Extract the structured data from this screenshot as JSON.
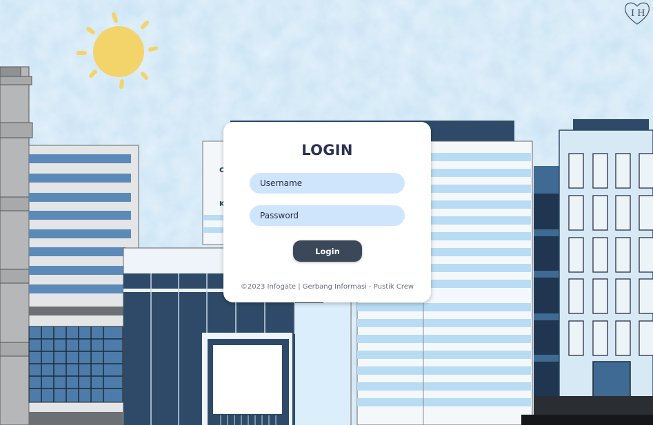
{
  "login": {
    "title": "LOGIN",
    "username_placeholder": "Username",
    "password_placeholder": "Password",
    "button_label": "Login",
    "footer": "©2023 Infogate | Gerbang Informasi - Pustik Crew"
  },
  "brand": {
    "logo_initials": "IH"
  },
  "colors": {
    "sky": "#cde6f5",
    "sun": "#f3d46b",
    "input_bg": "#cfe5fc",
    "button_bg": "#3a4859",
    "title": "#2b3152",
    "building_dark": "#2e4a68",
    "building_mid": "#5b8ab8",
    "building_light": "#b7dcf4"
  }
}
